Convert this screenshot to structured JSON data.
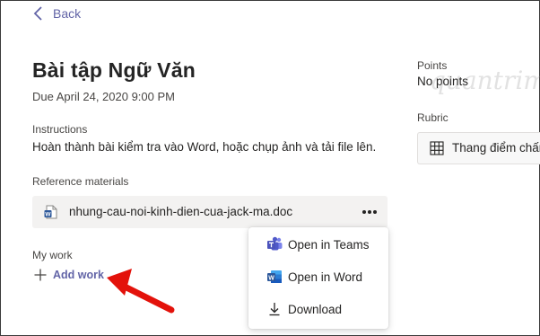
{
  "nav": {
    "back_label": "Back"
  },
  "assignment": {
    "title": "Bài tập Ngữ Văn",
    "due": "Due April 24, 2020 9:00 PM",
    "instructions_label": "Instructions",
    "instructions_text": "Hoàn thành bài kiểm tra vào Word, hoặc chụp ảnh và tải file lên.",
    "reference_label": "Reference materials",
    "reference_file": {
      "name": "nhung-cau-noi-kinh-dien-cua-jack-ma.doc",
      "icon": "word-doc-icon"
    },
    "my_work_label": "My work",
    "add_work_label": "Add work"
  },
  "context_menu": {
    "items": [
      {
        "label": "Open in Teams",
        "icon": "teams-icon"
      },
      {
        "label": "Open in Word",
        "icon": "word-icon"
      },
      {
        "label": "Download",
        "icon": "download-icon"
      }
    ]
  },
  "sidebar": {
    "points_label": "Points",
    "points_value": "No points",
    "rubric_label": "Rubric",
    "rubric_value": "Thang điểm chấm"
  },
  "watermark": "quantrimang",
  "colors": {
    "accent": "#6264a7",
    "annotation_arrow": "#e3120b",
    "word_blue": "#2b579a"
  }
}
